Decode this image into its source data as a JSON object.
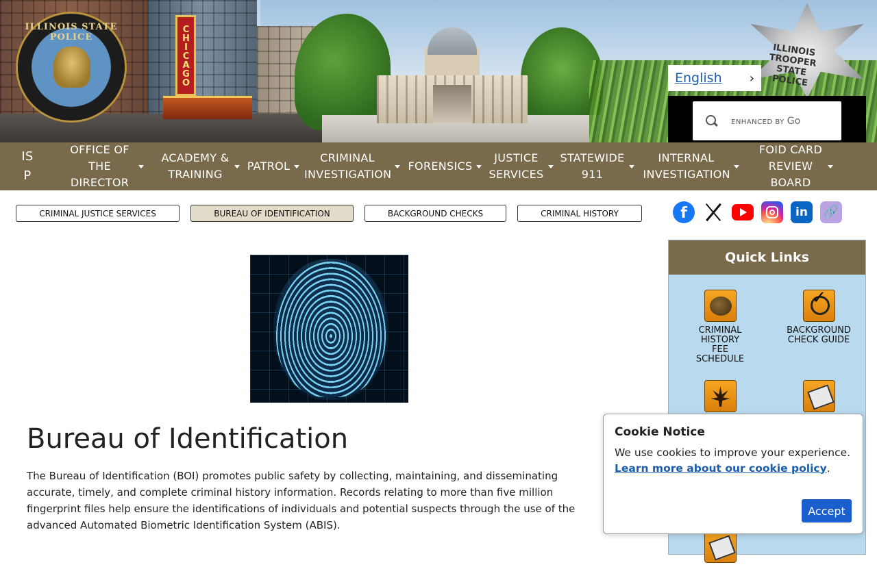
{
  "banner": {
    "seal_text": "ILLINOIS STATE POLICE",
    "sign_text": "CHICAGO",
    "badge_text": "ILLINOIS TROOPER STATE POLICE"
  },
  "language": {
    "label": "English",
    "chevron": "›"
  },
  "search": {
    "enhanced_by": "ENHANCED BY",
    "brand": "Go",
    "icon": "search-icon"
  },
  "nav": {
    "items": [
      {
        "label": "IS P"
      },
      {
        "label": "OFFICE OF THE DIRECTOR"
      },
      {
        "label": "ACADEMY & TRAINING"
      },
      {
        "label": "PATROL"
      },
      {
        "label": "CRIMINAL INVESTIGATION"
      },
      {
        "label": "FORENSICS"
      },
      {
        "label": "JUSTICE SERVICES"
      },
      {
        "label": "STATEWIDE 911"
      },
      {
        "label": "INTERNAL INVESTIGATION"
      },
      {
        "label": "FOID CARD REVIEW BOARD"
      }
    ]
  },
  "subnav": {
    "items": [
      {
        "label": "CRIMINAL JUSTICE SERVICES"
      },
      {
        "label": "BUREAU OF IDENTIFICATION"
      },
      {
        "label": "BACKGROUND CHECKS"
      },
      {
        "label": "CRIMINAL HISTORY"
      }
    ],
    "active_index": 1
  },
  "social": {
    "facebook": "f",
    "linkedin": "in",
    "link": "🔗"
  },
  "main": {
    "title": "Bureau of Identification",
    "intro": "The Bureau of Identification (BOI) promotes public safety by collecting, maintaining, and disseminating accurate, timely, and complete criminal history information. Records relating to more than five million fingerprint files help ensure the identifications of individuals and potential suspects through the use of the advanced Automated Biometric Identification System (ABIS)."
  },
  "quick_links": {
    "heading": "Quick Links",
    "items": [
      {
        "label": "CRIMINAL HISTORY FEE SCHEDULE"
      },
      {
        "label": "BACKGROUND CHECK GUIDE"
      }
    ]
  },
  "cookie": {
    "title": "Cookie Notice",
    "text": "We use cookies to improve your experience.",
    "link": "Learn more about our cookie policy",
    "period": ".",
    "accept": "Accept"
  },
  "colors": {
    "nav_bg": "#7a6a4c",
    "quick_links_bg": "#b8d9ee",
    "link": "#1b5faa",
    "accept_button": "#1b5fcf"
  }
}
